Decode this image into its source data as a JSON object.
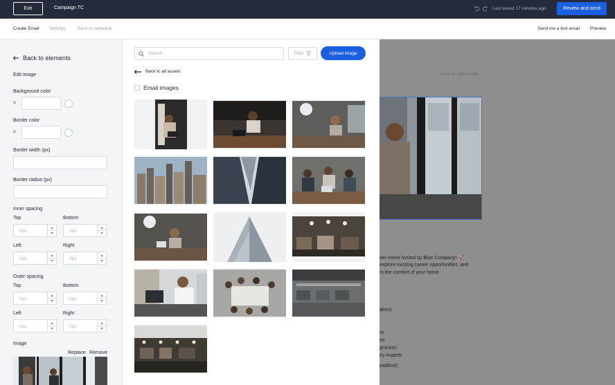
{
  "topbar": {
    "exit_label": "Exit",
    "campaign_name": "Campaign TC",
    "saved_status": "Last saved 17 minutes ago",
    "review_label": "Review and send"
  },
  "nav": {
    "tabs": [
      "Create Email",
      "Settings",
      "Send or schedule"
    ],
    "test_email": "Send me a test email",
    "preview": "Preview"
  },
  "left_panel": {
    "back_label": "Back to elements",
    "edit_image": "Edit image",
    "background_color": "Background color",
    "border_color": "Border color",
    "hash": "#",
    "border_width": "Border width (px)",
    "border_radius": "Border radius (px)",
    "inner_spacing": "Inner spacing",
    "outer_spacing": "Outer spacing",
    "top": "Top",
    "bottom": "Bottom",
    "left": "Left",
    "right": "Right",
    "placeholder_px": "0px",
    "image_label": "Image",
    "replace": "Replace",
    "remove": "Remove"
  },
  "assets": {
    "search_placeholder": "Search",
    "filter_label": "Filter",
    "upload_label": "Upload image",
    "back_label": "Back to all assets",
    "section_title": "Email images",
    "images": [
      "woman-laptop-portrait",
      "woman-laptop-desk",
      "woman-neon-office",
      "city-skyline",
      "skyscrapers-low-angle",
      "team-meeting",
      "woman-neon-office-2",
      "tower-fog",
      "cafe-office",
      "man-desk-monitors",
      "team-table-topdown",
      "open-office",
      "office-bar-interior"
    ]
  },
  "preview": {
    "view_web": "View as Web Page",
    "lines": [
      "eer event hosted by Blue Company! 🚀",
      "explore exciting career opportunities, and",
      "m the comfort of your home.",
      "ation)",
      "re",
      "es",
      "process",
      "try experts",
      "eadline]!"
    ]
  },
  "colors": {
    "topbar": "#262b3c",
    "accent": "#1a5fe0",
    "preview_bg": "#8e8e8e"
  }
}
